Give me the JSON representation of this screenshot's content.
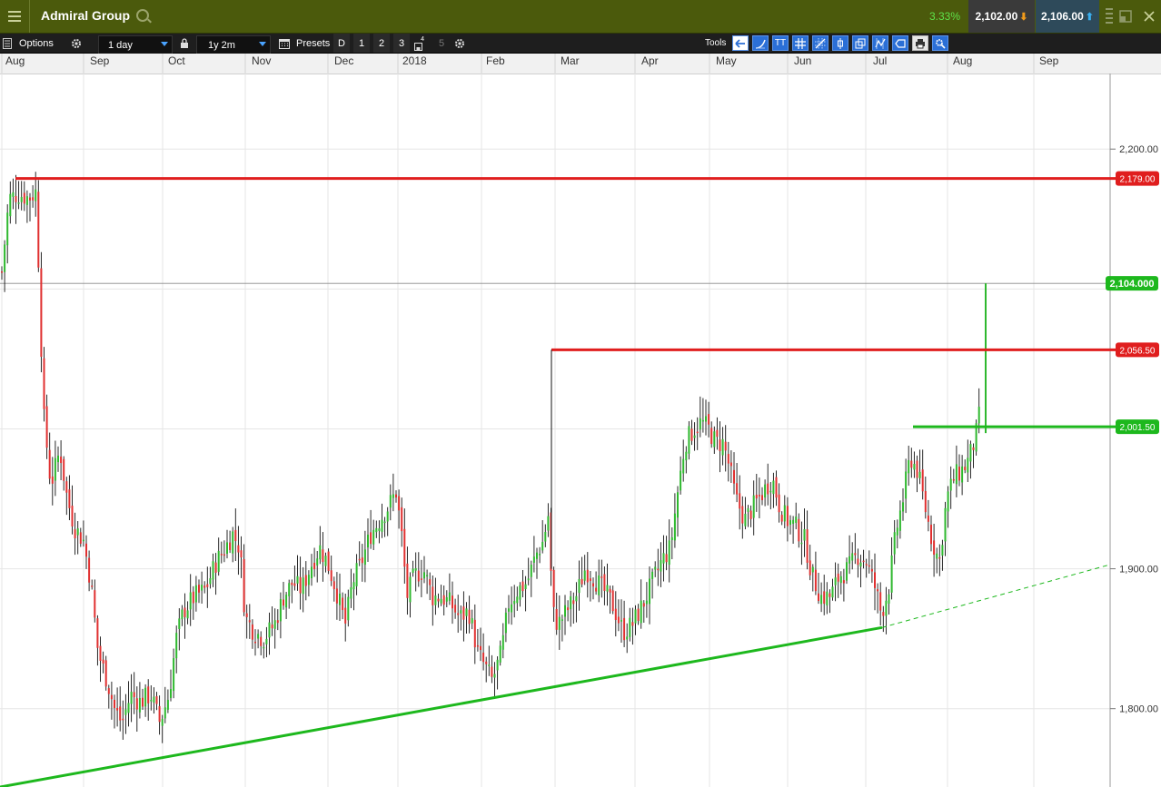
{
  "header": {
    "instrument": "Admiral Group",
    "change_pct": "3.33%",
    "bid": "2,102.00",
    "ask": "2,106.00",
    "bid_arrow": "⬇",
    "ask_arrow": "⬆",
    "bid_arrow_icon": "down-arrow-icon",
    "ask_arrow_icon": "up-arrow-icon"
  },
  "toolbar": {
    "options_label": "Options",
    "interval": "1 day",
    "range": "1y 2m",
    "presets_label": "Presets",
    "presets": [
      "D",
      "1",
      "2",
      "3",
      "4",
      "5"
    ],
    "tools_label": "Tools",
    "tools_text_icon": "TT"
  },
  "colors": {
    "title_bar": "#4b5a0c",
    "up_bar": "#2fb82f",
    "down_bar": "#e03030",
    "resistance": "#e01e1e",
    "support": "#1db81d"
  },
  "chart_data": {
    "type": "ohlc",
    "x_labels": [
      "Aug",
      "Sep",
      "Oct",
      "Nov",
      "Dec",
      "2018",
      "Feb",
      "Mar",
      "Apr",
      "May",
      "Jun",
      "Jul",
      "Aug",
      "Sep"
    ],
    "y_ticks": [
      "2,200.00",
      "1,900.00",
      "1,800.00"
    ],
    "y_tick_values": [
      2200,
      1900,
      1800
    ],
    "ylim": [
      1744,
      2254
    ],
    "last_price": 2104,
    "last_price_label": "2,104.000",
    "horizontal_levels": [
      {
        "value": 2179,
        "label": "2,179.00",
        "color": "red"
      },
      {
        "value": 2056.5,
        "label": "2,056.50",
        "color": "red"
      },
      {
        "value": 2001.5,
        "label": "2,001.50",
        "color": "green"
      }
    ],
    "trendline": {
      "start": [
        0,
        1744
      ],
      "end": [
        971,
        1858
      ],
      "extension_end": [
        1222,
        1903
      ]
    },
    "anchors": [
      [
        0,
        2099
      ],
      [
        10,
        2165
      ],
      [
        20,
        2168
      ],
      [
        32,
        2165
      ],
      [
        40,
        2170
      ],
      [
        44,
        2085
      ],
      [
        48,
        2010
      ],
      [
        56,
        1960
      ],
      [
        66,
        1985
      ],
      [
        74,
        1950
      ],
      [
        82,
        1930
      ],
      [
        92,
        1920
      ],
      [
        100,
        1890
      ],
      [
        108,
        1840
      ],
      [
        118,
        1820
      ],
      [
        126,
        1800
      ],
      [
        134,
        1790
      ],
      [
        144,
        1810
      ],
      [
        154,
        1805
      ],
      [
        166,
        1810
      ],
      [
        176,
        1790
      ],
      [
        186,
        1810
      ],
      [
        194,
        1850
      ],
      [
        202,
        1870
      ],
      [
        214,
        1880
      ],
      [
        226,
        1885
      ],
      [
        238,
        1905
      ],
      [
        248,
        1915
      ],
      [
        256,
        1925
      ],
      [
        264,
        1915
      ],
      [
        270,
        1865
      ],
      [
        280,
        1855
      ],
      [
        290,
        1850
      ],
      [
        302,
        1860
      ],
      [
        312,
        1880
      ],
      [
        322,
        1890
      ],
      [
        332,
        1885
      ],
      [
        344,
        1905
      ],
      [
        352,
        1915
      ],
      [
        360,
        1905
      ],
      [
        370,
        1885
      ],
      [
        380,
        1860
      ],
      [
        388,
        1890
      ],
      [
        398,
        1905
      ],
      [
        408,
        1925
      ],
      [
        418,
        1935
      ],
      [
        428,
        1945
      ],
      [
        436,
        1955
      ],
      [
        442,
        1925
      ],
      [
        448,
        1880
      ],
      [
        456,
        1895
      ],
      [
        466,
        1900
      ],
      [
        476,
        1880
      ],
      [
        486,
        1880
      ],
      [
        496,
        1875
      ],
      [
        506,
        1865
      ],
      [
        516,
        1870
      ],
      [
        526,
        1840
      ],
      [
        534,
        1830
      ],
      [
        542,
        1820
      ],
      [
        552,
        1840
      ],
      [
        560,
        1875
      ],
      [
        570,
        1885
      ],
      [
        580,
        1890
      ],
      [
        590,
        1910
      ],
      [
        598,
        1920
      ],
      [
        604,
        1940
      ],
      [
        608,
        1870
      ],
      [
        614,
        1860
      ],
      [
        624,
        1870
      ],
      [
        634,
        1880
      ],
      [
        644,
        1900
      ],
      [
        652,
        1895
      ],
      [
        664,
        1885
      ],
      [
        674,
        1875
      ],
      [
        686,
        1855
      ],
      [
        696,
        1860
      ],
      [
        708,
        1875
      ],
      [
        718,
        1890
      ],
      [
        728,
        1905
      ],
      [
        738,
        1915
      ],
      [
        746,
        1955
      ],
      [
        754,
        1990
      ],
      [
        764,
        2000
      ],
      [
        772,
        2005
      ],
      [
        780,
        2000
      ],
      [
        788,
        1990
      ],
      [
        796,
        1990
      ],
      [
        802,
        1975
      ],
      [
        810,
        1950
      ],
      [
        820,
        1935
      ],
      [
        830,
        1945
      ],
      [
        840,
        1955
      ],
      [
        850,
        1965
      ],
      [
        858,
        1945
      ],
      [
        866,
        1935
      ],
      [
        876,
        1930
      ],
      [
        886,
        1920
      ],
      [
        894,
        1895
      ],
      [
        904,
        1880
      ],
      [
        914,
        1880
      ],
      [
        924,
        1895
      ],
      [
        934,
        1900
      ],
      [
        944,
        1910
      ],
      [
        954,
        1905
      ],
      [
        964,
        1885
      ],
      [
        970,
        1868
      ],
      [
        978,
        1885
      ],
      [
        986,
        1925
      ],
      [
        994,
        1950
      ],
      [
        1002,
        1980
      ],
      [
        1010,
        1970
      ],
      [
        1018,
        1945
      ],
      [
        1026,
        1920
      ],
      [
        1034,
        1905
      ],
      [
        1042,
        1950
      ],
      [
        1050,
        1965
      ],
      [
        1058,
        1970
      ],
      [
        1064,
        1975
      ],
      [
        1070,
        1985
      ],
      [
        1076,
        2000
      ],
      [
        1080,
        2020
      ],
      [
        1084,
        2104
      ]
    ]
  }
}
